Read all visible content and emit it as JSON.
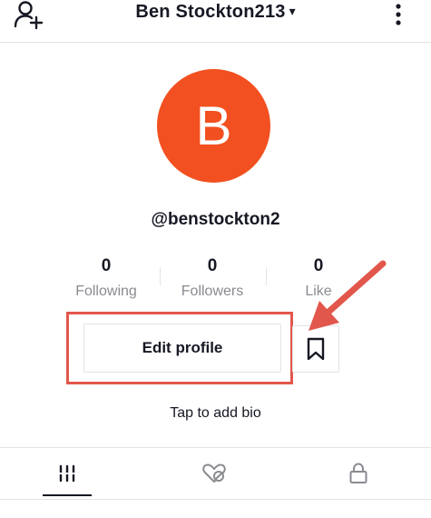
{
  "header": {
    "username": "Ben Stockton213",
    "caret": "▾",
    "icons": {
      "left": "add-user-icon",
      "right": "more-vertical-icon"
    }
  },
  "profile": {
    "avatar_letter": "B",
    "avatar_color": "#f25020",
    "handle": "@benstockton2"
  },
  "stats": [
    {
      "value": "0",
      "label": "Following"
    },
    {
      "value": "0",
      "label": "Followers"
    },
    {
      "value": "0",
      "label": "Like"
    }
  ],
  "actions": {
    "edit_profile": "Edit profile",
    "bookmark_icon": "bookmark-icon"
  },
  "bio": {
    "placeholder": "Tap to add bio"
  },
  "tabs": [
    {
      "icon": "grid-icon",
      "active": true
    },
    {
      "icon": "liked-hidden-icon",
      "active": false
    },
    {
      "icon": "lock-icon",
      "active": false
    }
  ],
  "annotation": {
    "color": "#e2574c"
  }
}
